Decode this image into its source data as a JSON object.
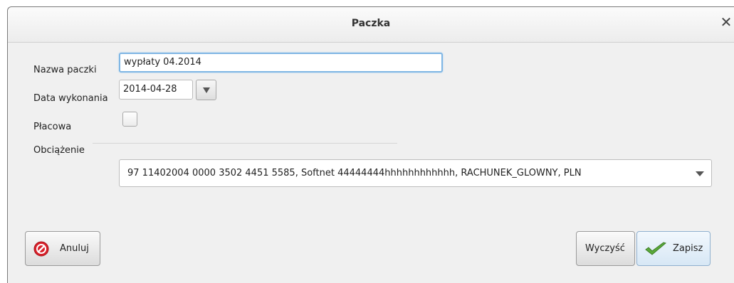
{
  "dialog": {
    "title": "Paczka",
    "close_glyph": "✕"
  },
  "form": {
    "name_label": "Nazwa paczki",
    "name_value": "wypłaty 04.2014",
    "date_label": "Data wykonania",
    "date_value": "2014-04-28",
    "payroll_label": "Płacowa",
    "payroll_checked": false,
    "debit_label": "Obciążenie",
    "debit_value": "97 11402004 0000 3502 4451 5585, Softnet 44444444hhhhhhhhhhhh, RACHUNEK_GLOWNY, PLN"
  },
  "buttons": {
    "cancel_label": "Anuluj",
    "clear_label": "Wyczyść",
    "save_label": "Zapisz"
  },
  "icons": {
    "cancel": "cancel-icon",
    "save": "checkmark-icon",
    "date_dropdown": "chevron-down-icon",
    "select_dropdown": "chevron-down-icon"
  },
  "colors": {
    "focus_border": "#7fb6e4",
    "cancel_icon": "#d8202a",
    "save_icon": "#5aa93a"
  }
}
